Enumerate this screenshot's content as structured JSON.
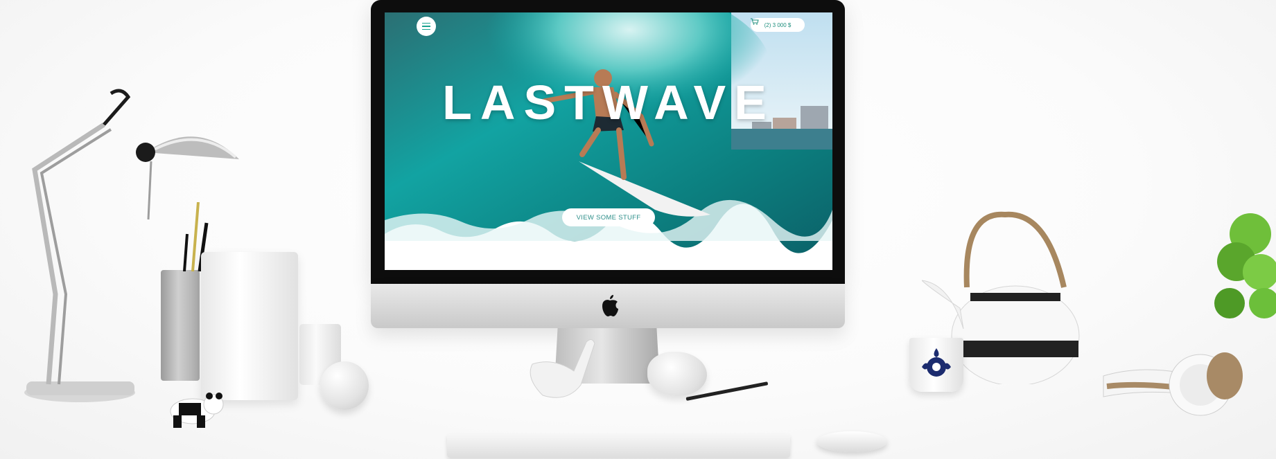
{
  "website": {
    "hero_title": "LASTWAVE",
    "cart_label": "(2) 3 000 $",
    "cta_label": "VIEW SOME STUFF"
  },
  "colors": {
    "accent": "#1aa28f",
    "screen_sea": "#0a6f74",
    "wave_highlight": "#bfe9ec"
  },
  "icons": {
    "menu": "hamburger-menu-icon",
    "cart": "shopping-cart-icon",
    "logo": "apple-logo-icon"
  }
}
